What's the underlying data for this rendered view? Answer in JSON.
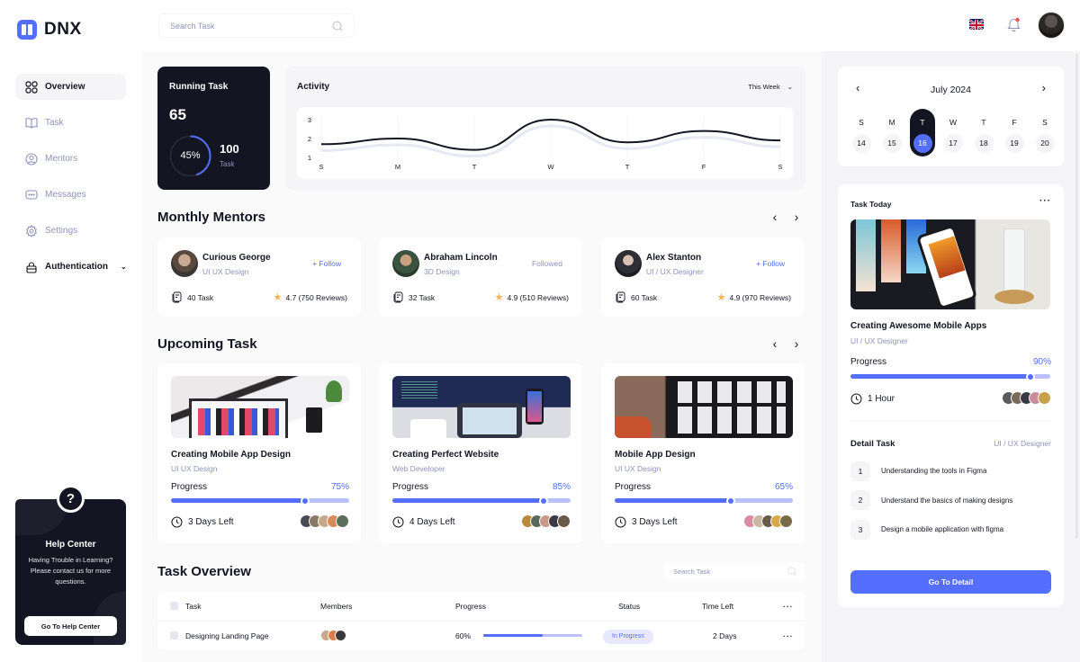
{
  "app": {
    "name": "DNX",
    "brand_color": "#546fff",
    "dark_color": "#141522"
  },
  "sidebar": {
    "items": [
      {
        "label": "Overview",
        "icon": "grid-icon",
        "active": true
      },
      {
        "label": "Task",
        "icon": "book-icon"
      },
      {
        "label": "Mentors",
        "icon": "user-circle-icon"
      },
      {
        "label": "Messages",
        "icon": "chat-icon"
      },
      {
        "label": "Settings",
        "icon": "gear-icon"
      },
      {
        "label": "Authentication",
        "icon": "lock-icon",
        "expandable": true
      }
    ],
    "help": {
      "title": "Help Center",
      "text": "Having Trouble in Learning? Please contact us for more questions.",
      "button": "Go To Help Center",
      "icon": "question-icon"
    }
  },
  "header": {
    "search_placeholder": "Search Task",
    "language": "English (UK)",
    "notification_dot": true
  },
  "running_task": {
    "title": "Running Task",
    "count": "65",
    "percent": 45,
    "percent_label": "45%",
    "total": "100",
    "total_label": "Task"
  },
  "activity": {
    "title": "Activity",
    "range": "This Week"
  },
  "chart_data": {
    "type": "line",
    "title": "Activity",
    "x": [
      "S",
      "M",
      "T",
      "W",
      "T",
      "F",
      "S"
    ],
    "series": [
      {
        "name": "Activity",
        "values": [
          1.7,
          2.0,
          1.4,
          3.0,
          1.8,
          2.4,
          1.9
        ]
      }
    ],
    "yticks": [
      1,
      2,
      3
    ],
    "ylim": [
      1,
      3
    ],
    "xlabel": "",
    "ylabel": "",
    "grid": true
  },
  "mentors": {
    "title": "Monthly Mentors",
    "items": [
      {
        "name": "Curious George",
        "role": "UI UX Design",
        "action": "+ Follow",
        "followed": false,
        "tasks": "40 Task",
        "rating": "4.7 (750 Reviews)"
      },
      {
        "name": "Abraham Lincoln",
        "role": "3D Design",
        "action": "Followed",
        "followed": true,
        "tasks": "32 Task",
        "rating": "4.9 (510 Reviews)"
      },
      {
        "name": "Alex Stanton",
        "role": "UI / UX Designer",
        "action": "+ Follow",
        "followed": false,
        "tasks": "60 Task",
        "rating": "4.9 (970 Reviews)"
      }
    ]
  },
  "upcoming": {
    "title": "Upcoming Task",
    "progress_label": "Progress",
    "items": [
      {
        "name": "Creating Mobile App Design",
        "role": "UI UX Design",
        "progress": 75,
        "progress_label": "75%",
        "time_left": "3 Days Left"
      },
      {
        "name": "Creating Perfect Website",
        "role": "Web Developer",
        "progress": 85,
        "progress_label": "85%",
        "time_left": "4 Days Left"
      },
      {
        "name": "Mobile App Design",
        "role": "UI UX Design",
        "progress": 65,
        "progress_label": "65%",
        "time_left": "3 Days Left"
      }
    ]
  },
  "overview": {
    "title": "Task Overview",
    "search_placeholder": "Search Task",
    "columns": [
      "Task",
      "Members",
      "Progress",
      "Status",
      "Time Left"
    ],
    "rows": [
      {
        "task": "Designing Landing Page",
        "progress": 60,
        "progress_label": "60%",
        "status": "In Progress",
        "time_left": "2 Days"
      }
    ]
  },
  "calendar": {
    "month": "July 2024",
    "days": [
      {
        "dow": "S",
        "date": "14"
      },
      {
        "dow": "M",
        "date": "15"
      },
      {
        "dow": "T",
        "date": "16",
        "selected": true
      },
      {
        "dow": "W",
        "date": "17"
      },
      {
        "dow": "T",
        "date": "18"
      },
      {
        "dow": "F",
        "date": "19"
      },
      {
        "dow": "S",
        "date": "20"
      }
    ]
  },
  "task_today": {
    "title": "Task Today",
    "name": "Creating Awesome Mobile Apps",
    "role": "UI / UX Designer",
    "progress_label": "Progress",
    "progress": 90,
    "progress_value": "90%",
    "time": "1 Hour",
    "detail_title": "Detail Task",
    "detail_role": "UI / UX Designer",
    "steps": [
      {
        "num": "1",
        "text": "Understanding the tools in Figma"
      },
      {
        "num": "2",
        "text": "Understand the basics of making designs"
      },
      {
        "num": "3",
        "text": "Design a mobile application with figma"
      }
    ],
    "button": "Go To Detail"
  }
}
